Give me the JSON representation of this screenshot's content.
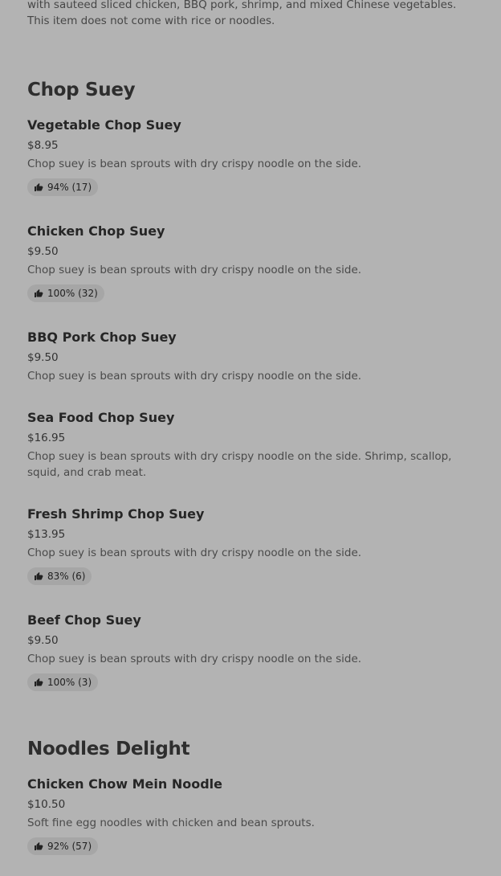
{
  "top_item": {
    "desc_line1": "with sauteed sliced chicken, BBQ pork, shrimp, and mixed Chinese vegetables.",
    "desc_line2": "This item does not come with rice or noodles."
  },
  "sections": [
    {
      "title": "Chop Suey",
      "items": [
        {
          "name": "Vegetable Chop Suey",
          "price": "$8.95",
          "desc": "Chop suey is bean sprouts with dry crispy noodle on the side.",
          "rating": "94% (17)"
        },
        {
          "name": "Chicken Chop Suey",
          "price": "$9.50",
          "desc": "Chop suey is bean sprouts with dry crispy noodle on the side.",
          "rating": "100% (32)"
        },
        {
          "name": "BBQ Pork Chop Suey",
          "price": "$9.50",
          "desc": "Chop suey is bean sprouts with dry crispy noodle on the side."
        },
        {
          "name": "Sea Food Chop Suey",
          "price": "$16.95",
          "desc": "Chop suey is bean sprouts with dry crispy noodle on the side. Shrimp, scallop, squid, and crab meat."
        },
        {
          "name": "Fresh Shrimp Chop Suey",
          "price": "$13.95",
          "desc": "Chop suey is bean sprouts with dry crispy noodle on the side.",
          "rating": "83% (6)"
        },
        {
          "name": "Beef Chop Suey",
          "price": "$9.50",
          "desc": "Chop suey is bean sprouts with dry crispy noodle on the side.",
          "rating": "100% (3)"
        }
      ]
    },
    {
      "title": "Noodles Delight",
      "items": [
        {
          "name": "Chicken Chow Mein Noodle",
          "price": "$10.50",
          "desc": "Soft fine egg noodles with chicken and bean sprouts.",
          "rating": "92% (57)"
        }
      ]
    }
  ]
}
